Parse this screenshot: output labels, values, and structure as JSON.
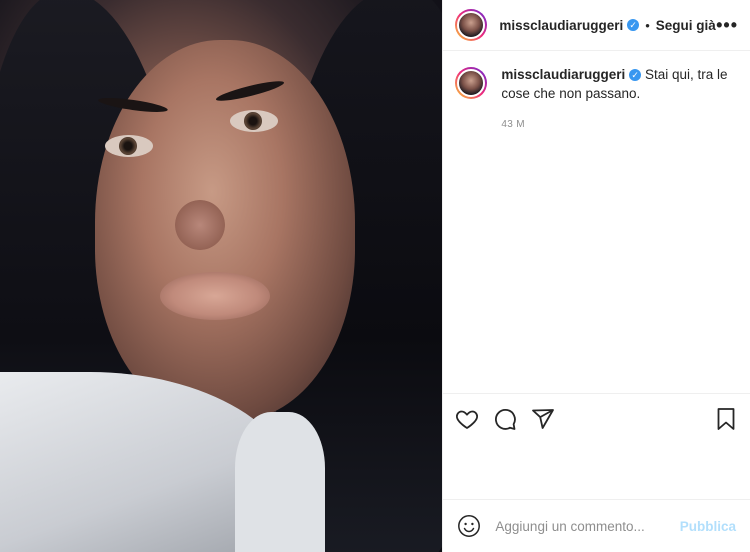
{
  "post": {
    "username": "missclaudiaruggeri",
    "follow_status": "Segui già",
    "dot": "•",
    "more": "•••",
    "caption": "Stai qui, tra le cose che non passano.",
    "time": "43 m"
  },
  "comment": {
    "placeholder": "Aggiungi un commento...",
    "publish_label": "Pubblica"
  },
  "icons": {
    "verified": "verified-badge-icon",
    "like": "heart-icon",
    "comment": "comment-icon",
    "share": "share-icon",
    "save": "bookmark-icon",
    "emoji": "emoji-icon"
  },
  "colors": {
    "verified": "#3897f0",
    "publish": "#b2dffc",
    "muted": "#8e8e8e"
  }
}
